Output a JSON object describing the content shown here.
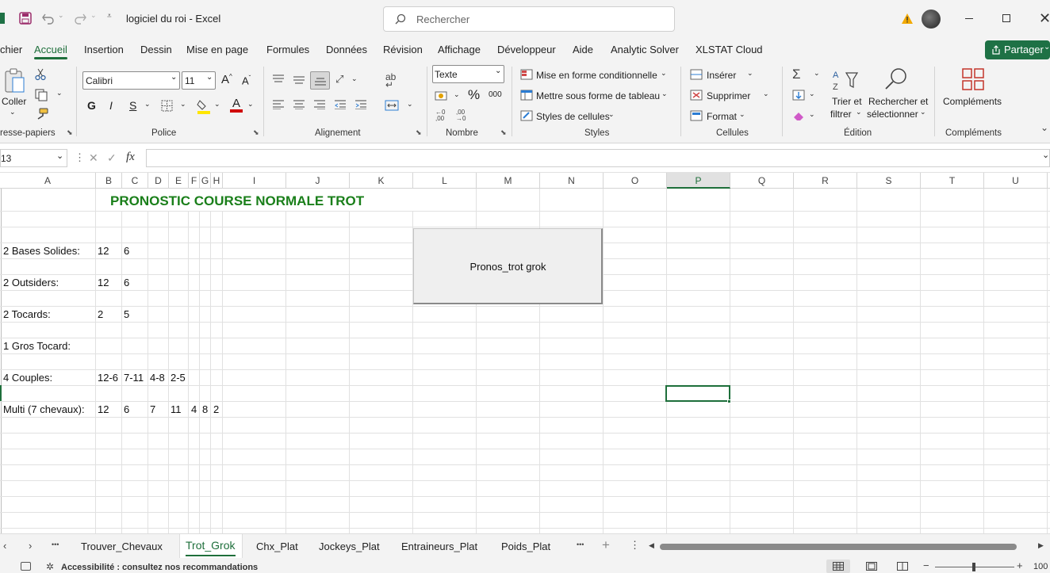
{
  "titlebar": {
    "doc_title": "logiciel du roi  -  Excel",
    "search_placeholder": "Rechercher"
  },
  "menu": {
    "items": [
      "chier",
      "Accueil",
      "Insertion",
      "Dessin",
      "Mise en page",
      "Formules",
      "Données",
      "Révision",
      "Affichage",
      "Développeur",
      "Aide",
      "Analytic Solver",
      "XLSTAT Cloud"
    ],
    "active": "Accueil",
    "share_label": "Partager"
  },
  "ribbon": {
    "paste_label": "Coller",
    "font_name": "Calibri",
    "font_size": "11",
    "bold_label": "G",
    "italic_label": "I",
    "underline_label": "S",
    "number_format": "Texte",
    "percent_label": "%",
    "thousands_label": "000",
    "cond_format_label": "Mise en forme conditionnelle",
    "table_format_label": "Mettre sous forme de tableau",
    "cell_styles_label": "Styles de cellules",
    "insert_label": "Insérer",
    "delete_label": "Supprimer",
    "format_label": "Format",
    "sort_label_1": "Trier et",
    "sort_label_2": "filtrer",
    "find_label_1": "Rechercher et",
    "find_label_2": "sélectionner",
    "addins_label": "Compléments",
    "groups": {
      "clipboard": "resse-papiers",
      "font": "Police",
      "alignment": "Alignement",
      "number": "Nombre",
      "styles": "Styles",
      "cells": "Cellules",
      "editing": "Édition",
      "addins": "Compléments"
    }
  },
  "formula_bar": {
    "name_box": "13",
    "fx_label": "fx",
    "formula": ""
  },
  "columns": [
    "A",
    "B",
    "C",
    "D",
    "E",
    "F",
    "G",
    "H",
    "I",
    "J",
    "K",
    "L",
    "M",
    "N",
    "O",
    "P",
    "Q",
    "R",
    "S",
    "T",
    "U"
  ],
  "selected_column": "P",
  "sheet": {
    "title": "PRONOSTIC COURSE NORMALE TROT",
    "title_color": "#1a7f1a",
    "rows": [
      {
        "label": "2 Bases Solides:",
        "values": [
          "12",
          "6"
        ]
      },
      {
        "label": "2 Outsiders:",
        "values": [
          "12",
          "6"
        ]
      },
      {
        "label": "2 Tocards:",
        "values": [
          "2",
          "5"
        ]
      },
      {
        "label": "1 Gros Tocard:",
        "values": []
      },
      {
        "label": "4 Couples:",
        "values": [
          "12-6",
          "7-11",
          "4-8",
          "2-5"
        ]
      },
      {
        "label": "Multi (7 chevaux):",
        "values": [
          "12",
          "6",
          "7",
          "11",
          "4",
          "8",
          "2"
        ]
      }
    ],
    "button_label": "Pronos_trot grok"
  },
  "tabs": {
    "items": [
      "Trouver_Chevaux",
      "Trot_Grok",
      "Chx_Plat",
      "Jockeys_Plat",
      "Entraineurs_Plat",
      "Poids_Plat"
    ],
    "active": "Trot_Grok",
    "more": "•••"
  },
  "status": {
    "accessibility": "Accessibilité : consultez nos recommandations",
    "zoom": "100"
  },
  "colors": {
    "accent": "#1e6f3b",
    "share_bg": "#1e7145"
  }
}
